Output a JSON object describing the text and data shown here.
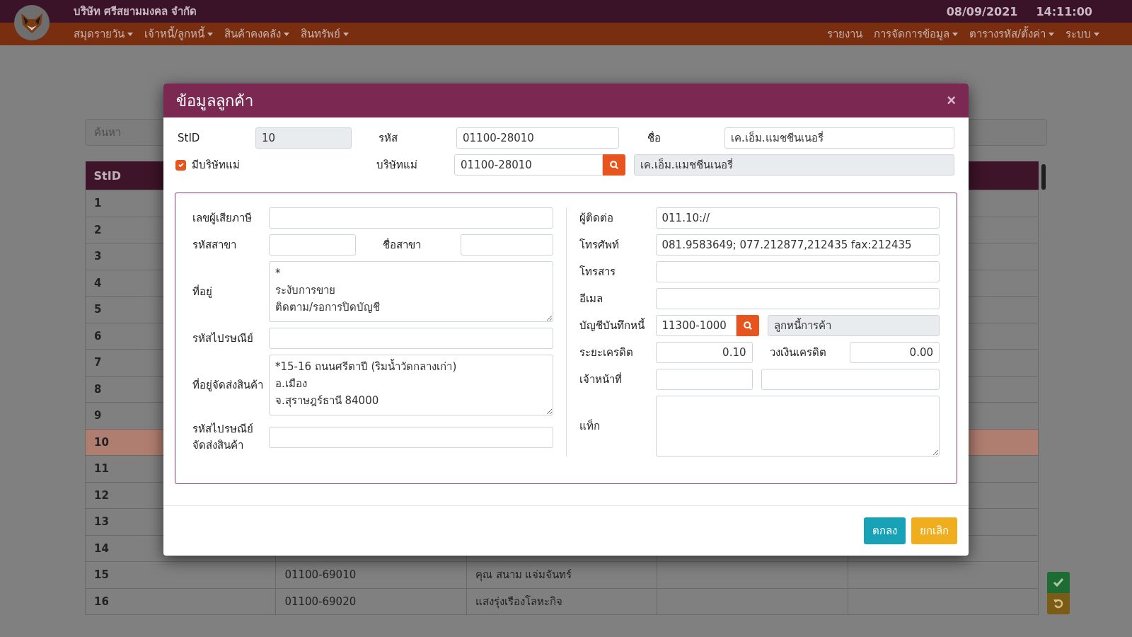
{
  "navbar": {
    "company": "บริษัท ศรีสยามมงคล จำกัด",
    "date": "08/09/2021",
    "time": "14:11:00",
    "menu_left": [
      {
        "label": "สมุดรายวัน",
        "dropdown": true
      },
      {
        "label": "เจ้าหนี้/ลูกหนี้",
        "dropdown": true
      },
      {
        "label": "สินค้าคงคลัง",
        "dropdown": true
      },
      {
        "label": "สินทรัพย์",
        "dropdown": true
      }
    ],
    "menu_right": [
      {
        "label": "รายงาน",
        "dropdown": false
      },
      {
        "label": "การจัดการข้อมูล",
        "dropdown": true
      },
      {
        "label": "ตารางรหัส/ตั้งค่า",
        "dropdown": true
      },
      {
        "label": "ระบบ",
        "dropdown": true
      }
    ]
  },
  "page": {
    "search": {
      "placeholder": "ค้นหา"
    },
    "table": {
      "columns": [
        "StID"
      ],
      "rows": [
        {
          "stid": "1",
          "selected": false
        },
        {
          "stid": "2",
          "selected": false
        },
        {
          "stid": "3",
          "selected": false
        },
        {
          "stid": "4",
          "selected": false
        },
        {
          "stid": "5",
          "selected": false
        },
        {
          "stid": "6",
          "selected": false
        },
        {
          "stid": "7",
          "selected": false
        },
        {
          "stid": "8",
          "selected": false
        },
        {
          "stid": "9",
          "selected": false
        },
        {
          "stid": "10",
          "selected": true
        },
        {
          "stid": "11",
          "selected": false
        },
        {
          "stid": "12",
          "selected": false
        },
        {
          "stid": "13",
          "selected": false
        },
        {
          "stid": "14",
          "selected": false
        },
        {
          "stid": "15",
          "code": "01100-69010",
          "name": "คุณ สนาม แจ่มจันทร์",
          "selected": false
        },
        {
          "stid": "16",
          "code": "01100-69020",
          "name": "แสงรุ่งเรืองโลหะกิจ",
          "selected": false
        }
      ]
    }
  },
  "modal": {
    "title": "ข้อมูลลูกค้า",
    "close": "×",
    "stid": {
      "label": "StID",
      "value": "10",
      "readonly": true
    },
    "code": {
      "label": "รหัส",
      "value": "01100-28010"
    },
    "name": {
      "label": "ชื่อ",
      "value": "เค.เอ็ม.แมชชีนเนอรี่"
    },
    "has_parent": {
      "label": "มีบริษัทแม่",
      "checked": true
    },
    "parent": {
      "label": "บริษัทแม่",
      "value": "01100-28010",
      "name_value": "เค.เอ็ม.แมชชีนเนอรี่"
    },
    "tax_id": {
      "label": "เลขผู้เสียภาษี"
    },
    "branch_code": {
      "label": "รหัสสาขา"
    },
    "branch_name": {
      "label": "ชื่อสาขา"
    },
    "address": {
      "label": "ที่อยู่",
      "value": "*\nระงับการขาย\nติดตาม/รอการปิดบัญชี"
    },
    "postcode": {
      "label": "รหัสไปรษณีย์"
    },
    "ship_address": {
      "label": "ที่อยู่จัดส่งสินค้า",
      "value": "*15-16 ถนนศรีตาปี (ริมน้ำวัดกลางเก่า)\nอ.เมือง\nจ.สุราษฎร์ธานี 84000"
    },
    "ship_postcode": {
      "label_lines": [
        "รหัสไปรษณีย์",
        "จัดส่งสินค้า"
      ]
    },
    "contact": {
      "label": "ผู้ติดต่อ",
      "value": "011.10://"
    },
    "phone": {
      "label": "โทรศัพท์",
      "value": "081.9583649; 077.212877,212435 fax:212435"
    },
    "fax": {
      "label": "โทรสาร"
    },
    "email": {
      "label": "อีเมล"
    },
    "account": {
      "label": "บัญชีบันทึกหนี้",
      "value": "11300-1000",
      "name_value": "ลูกหนี้การค้า"
    },
    "credit_term": {
      "label": "ระยะเครดิต",
      "value": "0.10"
    },
    "credit_limit": {
      "label": "วงเงินเครดิต",
      "value": "0.00"
    },
    "officer": {
      "label": "เจ้าหน้าที่"
    },
    "tag": {
      "label": "แท็ก"
    },
    "buttons": [
      {
        "label": "ตกลง",
        "kind": "primary"
      },
      {
        "label": "ยกเลิก",
        "kind": "cancel"
      }
    ]
  },
  "side_buttons": [
    {
      "kind": "save"
    },
    {
      "kind": "undo"
    }
  ]
}
